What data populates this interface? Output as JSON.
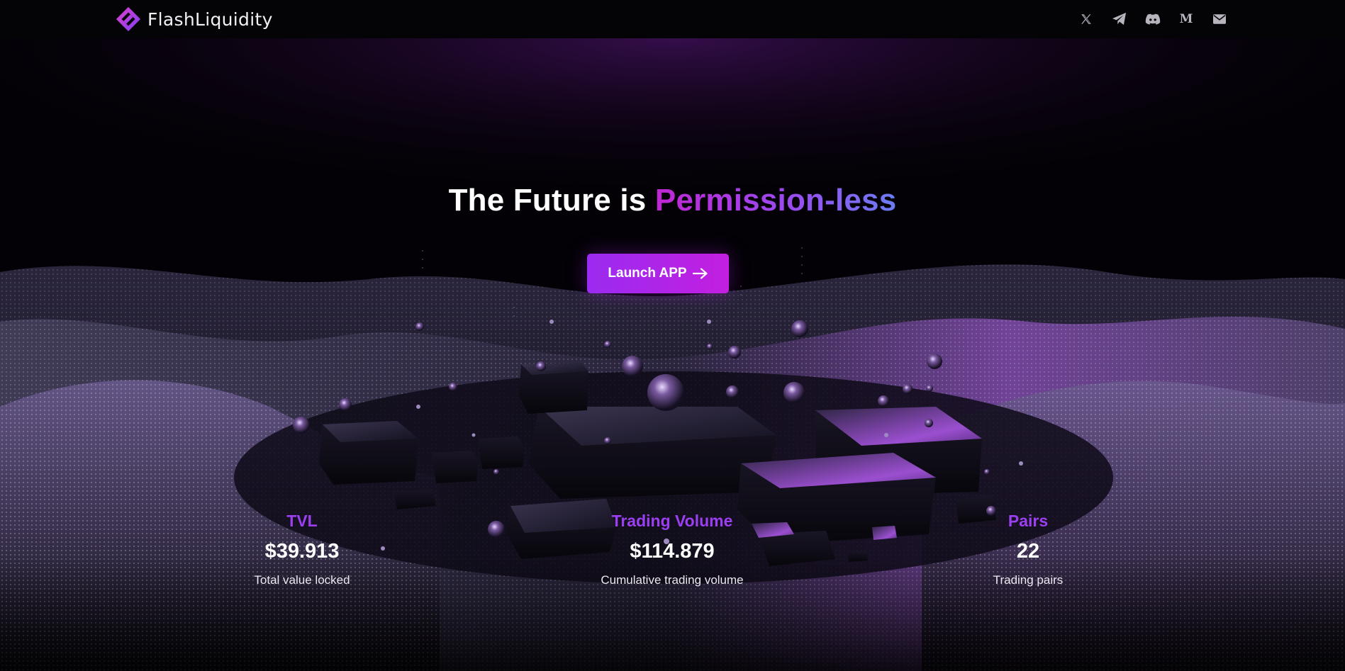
{
  "navbar": {
    "brand_name": "FlashLiquidity",
    "socials": [
      {
        "icon": "x-twitter-icon"
      },
      {
        "icon": "telegram-icon"
      },
      {
        "icon": "discord-icon"
      },
      {
        "icon": "medium-icon",
        "glyph": "M"
      },
      {
        "icon": "mail-icon"
      }
    ]
  },
  "hero": {
    "title_prefix": "The Future is ",
    "title_highlight": "Permission-less",
    "cta_label": "Launch APP",
    "cta_icon": "arrow-right-icon"
  },
  "stats": [
    {
      "title": "TVL",
      "value": "$39.913",
      "description": "Total value locked"
    },
    {
      "title": "Trading Volume",
      "value": "$114.879",
      "description": "Cumulative trading volume"
    },
    {
      "title": "Pairs",
      "value": "22",
      "description": "Trading pairs"
    }
  ],
  "colors": {
    "background": "#030106",
    "accent_purple": "#9b3ff0",
    "accent_magenta": "#c31fe0",
    "accent_blue": "#6b7cf3",
    "text_white": "#ffffff"
  }
}
